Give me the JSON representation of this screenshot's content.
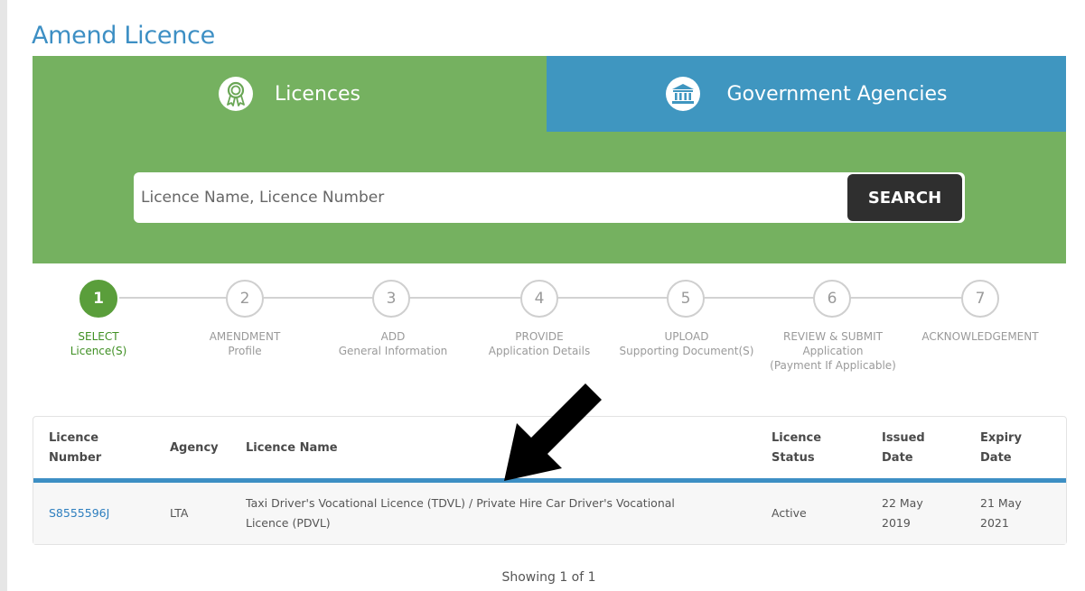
{
  "page": {
    "title": "Amend Licence"
  },
  "tabs": [
    {
      "label": "Licences",
      "icon": "award-ribbon-icon",
      "color": "#75b160"
    },
    {
      "label": "Government Agencies",
      "icon": "government-building-icon",
      "color": "#3f96c0"
    }
  ],
  "search": {
    "placeholder": "Licence Name, Licence Number",
    "value": "",
    "button_label": "SEARCH"
  },
  "steps": [
    {
      "number": "1",
      "line1": "Select",
      "line2": "Licence(S)",
      "active": true
    },
    {
      "number": "2",
      "line1": "Amendment",
      "line2": "Profile",
      "active": false
    },
    {
      "number": "3",
      "line1": "Add",
      "line2": "General Information",
      "active": false
    },
    {
      "number": "4",
      "line1": "Provide",
      "line2": "Application Details",
      "active": false
    },
    {
      "number": "5",
      "line1": "Upload",
      "line2": "Supporting Document(S)",
      "active": false
    },
    {
      "number": "6",
      "line1": "Review & Submit",
      "line2": "Application",
      "line3": "(Payment If Applicable)",
      "active": false
    },
    {
      "number": "7",
      "line1": "Acknowledgement",
      "line2": "",
      "active": false
    }
  ],
  "table": {
    "headers": {
      "licence_number": [
        "Licence",
        "Number"
      ],
      "agency": "Agency",
      "licence_name": "Licence Name",
      "licence_status": [
        "Licence",
        "Status"
      ],
      "issued_date": [
        "Issued",
        "Date"
      ],
      "expiry_date": [
        "Expiry",
        "Date"
      ]
    },
    "rows": [
      {
        "licence_number": "S8555596J",
        "agency": "LTA",
        "licence_name_line1": "Taxi Driver's Vocational Licence (TDVL) / Private Hire Car Driver's Vocational",
        "licence_name_line2": "Licence (PDVL)",
        "licence_status": "Active",
        "issued_date": [
          "22 May",
          "2019"
        ],
        "expiry_date": [
          "21 May",
          "2021"
        ]
      }
    ]
  },
  "pager": {
    "text": "Showing 1 of 1"
  },
  "colors": {
    "accent_blue": "#3d8fc4",
    "green": "#75b160",
    "active_step": "#5a9e3b",
    "search_button": "#2f2f2f"
  }
}
